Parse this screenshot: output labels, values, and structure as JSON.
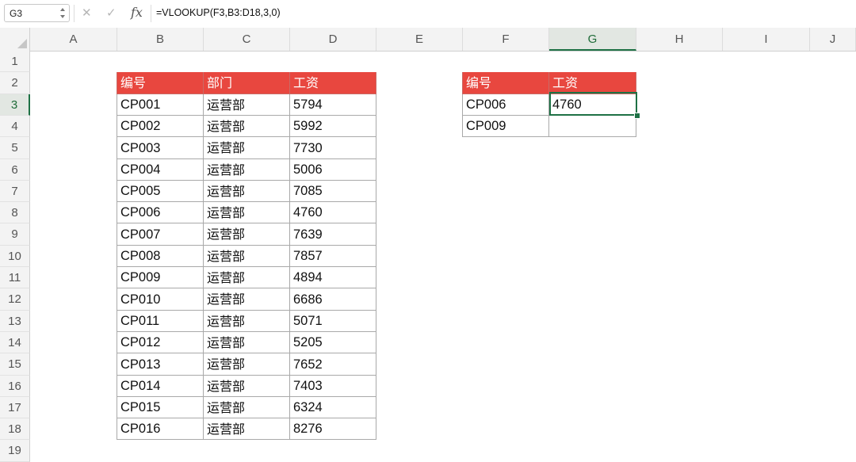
{
  "formula_bar": {
    "name_box": "G3",
    "formula": "=VLOOKUP(F3,B3:D18,3,0)",
    "fx_label": "fx",
    "cancel_glyph": "✕",
    "confirm_glyph": "✓"
  },
  "columns": [
    "A",
    "B",
    "C",
    "D",
    "E",
    "F",
    "G",
    "H",
    "I",
    "J"
  ],
  "active_column": "G",
  "rows": [
    "1",
    "2",
    "3",
    "4",
    "5",
    "6",
    "7",
    "8",
    "9",
    "10",
    "11",
    "12",
    "13",
    "14",
    "15",
    "16",
    "17",
    "18",
    "19"
  ],
  "active_row": "3",
  "colors": {
    "header_fill": "#e8473f",
    "selection": "#1e7145"
  },
  "main_table": {
    "headers": [
      "编号",
      "部门",
      "工资"
    ],
    "rows": [
      [
        "CP001",
        "运营部",
        "5794"
      ],
      [
        "CP002",
        "运营部",
        "5992"
      ],
      [
        "CP003",
        "运营部",
        "7730"
      ],
      [
        "CP004",
        "运营部",
        "5006"
      ],
      [
        "CP005",
        "运营部",
        "7085"
      ],
      [
        "CP006",
        "运营部",
        "4760"
      ],
      [
        "CP007",
        "运营部",
        "7639"
      ],
      [
        "CP008",
        "运营部",
        "7857"
      ],
      [
        "CP009",
        "运营部",
        "4894"
      ],
      [
        "CP010",
        "运营部",
        "6686"
      ],
      [
        "CP011",
        "运营部",
        "5071"
      ],
      [
        "CP012",
        "运营部",
        "5205"
      ],
      [
        "CP013",
        "运营部",
        "7652"
      ],
      [
        "CP014",
        "运营部",
        "7403"
      ],
      [
        "CP015",
        "运营部",
        "6324"
      ],
      [
        "CP016",
        "运营部",
        "8276"
      ]
    ]
  },
  "lookup_table": {
    "headers": [
      "编号",
      "工资"
    ],
    "rows": [
      [
        "CP006",
        "4760"
      ],
      [
        "CP009",
        ""
      ]
    ]
  },
  "icons": {
    "cancel": "cancel-icon",
    "confirm": "confirm-icon",
    "function": "fx-icon",
    "stepper": "stepper-icon",
    "select_all": "select-all-icon"
  }
}
